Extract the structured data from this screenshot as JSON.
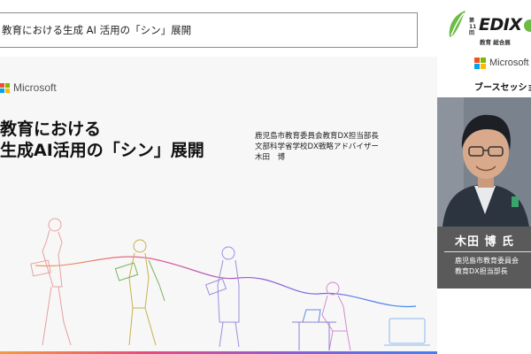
{
  "header": {
    "title": "教育における生成 AI 活用の「シン」展開"
  },
  "edix_logo": {
    "edition": "第11回",
    "word": "EDIX",
    "subtitle": "教育 総合展"
  },
  "sponsor": {
    "name": "Microsoft",
    "session_label": "ブースセッション"
  },
  "slide": {
    "brand": "Microsoft",
    "title_line1": "教育における",
    "title_line2": "生成AI活用の「シン」展開",
    "speaker_line1": "鹿児島市教育委員会教育DX担当部長",
    "speaker_line2": "文部科学省学校DX戦略アドバイザー",
    "speaker_line3": "木田　博"
  },
  "presenter": {
    "name": "木田 博 氏",
    "affiliation_line1": "鹿児島市教育委員会",
    "affiliation_line2": "教育DX担当部長"
  },
  "colors": {
    "ms_red": "#f25022",
    "ms_green": "#7fba00",
    "ms_blue": "#00a4ef",
    "ms_yellow": "#ffb900",
    "edix_green": "#6dbb45"
  }
}
